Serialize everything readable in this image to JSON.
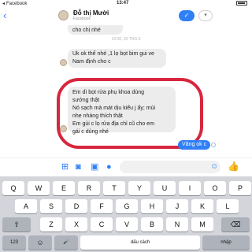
{
  "status_bar": {
    "back_app": "Facebook",
    "time": "13:47",
    "battery_percent": 80
  },
  "header": {
    "back_glyph": "‹",
    "contact_name": "Đỗ thị Mười",
    "contact_subtitle": "Facebook",
    "action_glyph": "✓",
    "action2_glyph": "▾"
  },
  "messages": [
    {
      "side": "in",
      "text": "cho chị nhé"
    },
    {
      "side": "meta",
      "text": "10:00, 20 THG 6"
    },
    {
      "side": "in",
      "text": "Uk ok thế nhé ,1 lọ bọt bim gui ve Nam định cho c"
    },
    {
      "side": "in",
      "lines": [
        "Em dì bọt rửa phụ khoa dùng",
        "sướng thật",
        "Nó sạch mà mát dịu kiểu j ấy; mùi",
        "nhẹ nhàng thích thật",
        "Em gủi c lọ rửa địa chỉ cũ cho em",
        "gái c dùng nhé"
      ]
    },
    {
      "side": "out",
      "text": "Vâng ok c"
    }
  ],
  "composer": {
    "icons": [
      "grid-icon",
      "camera-icon",
      "image-icon",
      "mic-icon"
    ],
    "emoji_icon": "emoji-icon",
    "like_icon": "like-icon"
  },
  "keyboard": {
    "row1": [
      "Q",
      "W",
      "E",
      "R",
      "T",
      "Y",
      "U",
      "I",
      "O",
      "P"
    ],
    "row2": [
      "A",
      "S",
      "D",
      "F",
      "G",
      "H",
      "J",
      "K",
      "L"
    ],
    "row3": [
      "Z",
      "X",
      "C",
      "V",
      "B",
      "N",
      "M"
    ],
    "shift": "⇧",
    "delete": "⌫",
    "numbers": "123",
    "emoji": "☺",
    "mic": "🎤",
    "space": "dấu cách",
    "return": "nhập"
  }
}
